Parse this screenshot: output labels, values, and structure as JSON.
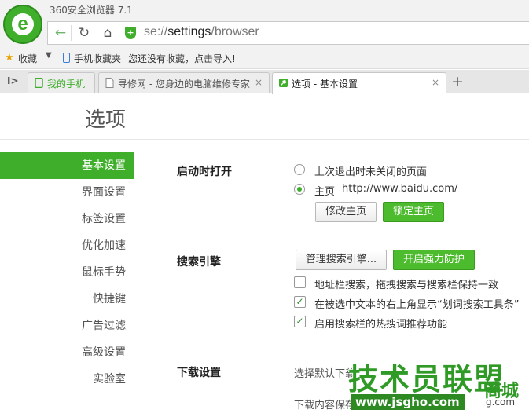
{
  "window": {
    "title": "360安全浏览器 7.1"
  },
  "nav": {
    "back_icon": "back-arrow-icon",
    "refresh_icon": "refresh-icon",
    "home_icon": "home-icon",
    "url_scheme": "se://",
    "url_host": "settings",
    "url_path": "/browser"
  },
  "bookmarks": {
    "favorites_label": "收藏",
    "mobile_label": "手机收藏夹",
    "hint": "您还没有收藏，点击导入!"
  },
  "tabs": [
    {
      "label": "我的手机"
    },
    {
      "label": "寻修网 - 您身边的电脑维修专家"
    },
    {
      "label": "选项 - 基本设置"
    }
  ],
  "tab_close": "×",
  "new_tab": "+",
  "page": {
    "title": "选项"
  },
  "sidebar": {
    "items": [
      {
        "label": "基本设置",
        "active": true
      },
      {
        "label": "界面设置"
      },
      {
        "label": "标签设置"
      },
      {
        "label": "优化加速"
      },
      {
        "label": "鼠标手势"
      },
      {
        "label": "快捷键"
      },
      {
        "label": "广告过滤"
      },
      {
        "label": "高级设置"
      },
      {
        "label": "实验室"
      }
    ]
  },
  "startup": {
    "label": "启动时打开",
    "option_restore": "上次退出时未关闭的页面",
    "option_home": "主页",
    "home_url": "http://www.baidu.com/",
    "selected": "home",
    "btn_modify": "修改主页",
    "btn_lock": "锁定主页"
  },
  "search": {
    "label": "搜索引擎",
    "btn_manage": "管理搜索引擎...",
    "btn_protect": "开启强力防护",
    "options": [
      {
        "label": "地址栏搜索，拖拽搜索与搜索栏保持一致",
        "checked": false
      },
      {
        "label": "在被选中文本的右上角显示“划词搜索工具条”",
        "checked": true
      },
      {
        "label": "启用搜索栏的热搜词推荐功能",
        "checked": true
      }
    ]
  },
  "download": {
    "label": "下载设置",
    "select_text": "选择默认下载",
    "location_text": "下载内容保存"
  },
  "watermark": {
    "line1": "技术员联盟",
    "line2": "www.jsgho.com",
    "line3": "商城",
    "line4": "g.com"
  },
  "colors": {
    "accent": "#3fae2b"
  }
}
